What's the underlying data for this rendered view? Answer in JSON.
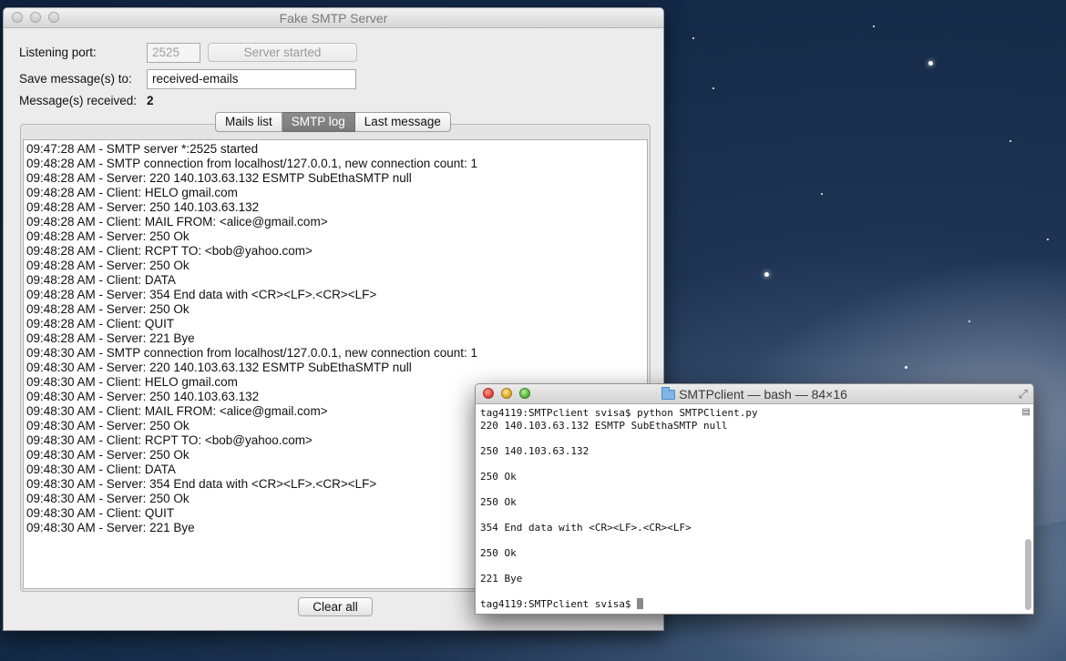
{
  "desktop": {
    "background_colors": [
      "#0f2240",
      "#3d5575",
      "#8a9bb0"
    ]
  },
  "server_window": {
    "title": "Fake SMTP Server",
    "listening_port_label": "Listening port:",
    "port_value": "2525",
    "server_button_label": "Server started",
    "save_label": "Save message(s) to:",
    "save_value": "received-emails",
    "received_label": "Message(s) received:",
    "received_count": "2",
    "tabs": [
      {
        "label": "Mails list"
      },
      {
        "label": "SMTP log"
      },
      {
        "label": "Last message"
      }
    ],
    "active_tab": "SMTP log",
    "log_lines": [
      "09:47:28 AM - SMTP server *:2525 started",
      "09:48:28 AM - SMTP connection from localhost/127.0.0.1, new connection count: 1",
      "09:48:28 AM - Server: 220 140.103.63.132 ESMTP SubEthaSMTP null",
      "09:48:28 AM - Client: HELO gmail.com",
      "09:48:28 AM - Server: 250 140.103.63.132",
      "09:48:28 AM - Client: MAIL FROM: <alice@gmail.com>",
      "09:48:28 AM - Server: 250 Ok",
      "09:48:28 AM - Client: RCPT TO: <bob@yahoo.com>",
      "09:48:28 AM - Server: 250 Ok",
      "09:48:28 AM - Client: DATA",
      "09:48:28 AM - Server: 354 End data with <CR><LF>.<CR><LF>",
      "09:48:28 AM - Server: 250 Ok",
      "09:48:28 AM - Client: QUIT",
      "09:48:28 AM - Server: 221 Bye",
      "09:48:30 AM - SMTP connection from localhost/127.0.0.1, new connection count: 1",
      "09:48:30 AM - Server: 220 140.103.63.132 ESMTP SubEthaSMTP null",
      "09:48:30 AM - Client: HELO gmail.com",
      "09:48:30 AM - Server: 250 140.103.63.132",
      "09:48:30 AM - Client: MAIL FROM: <alice@gmail.com>",
      "09:48:30 AM - Server: 250 Ok",
      "09:48:30 AM - Client: RCPT TO: <bob@yahoo.com>",
      "09:48:30 AM - Server: 250 Ok",
      "09:48:30 AM - Client: DATA",
      "09:48:30 AM - Server: 354 End data with <CR><LF>.<CR><LF>",
      "09:48:30 AM - Server: 250 Ok",
      "09:48:30 AM - Client: QUIT",
      "09:48:30 AM - Server: 221 Bye"
    ],
    "clear_button_label": "Clear all"
  },
  "terminal_window": {
    "title": "SMTPclient — bash — 84×16",
    "title_icon": "folder-icon",
    "lines": [
      "tag4119:SMTPclient svisa$ python SMTPClient.py",
      "220 140.103.63.132 ESMTP SubEthaSMTP null",
      "",
      "250 140.103.63.132",
      "",
      "250 Ok",
      "",
      "250 Ok",
      "",
      "354 End data with <CR><LF>.<CR><LF>",
      "",
      "250 Ok",
      "",
      "221 Bye",
      "",
      "tag4119:SMTPclient svisa$ "
    ]
  }
}
